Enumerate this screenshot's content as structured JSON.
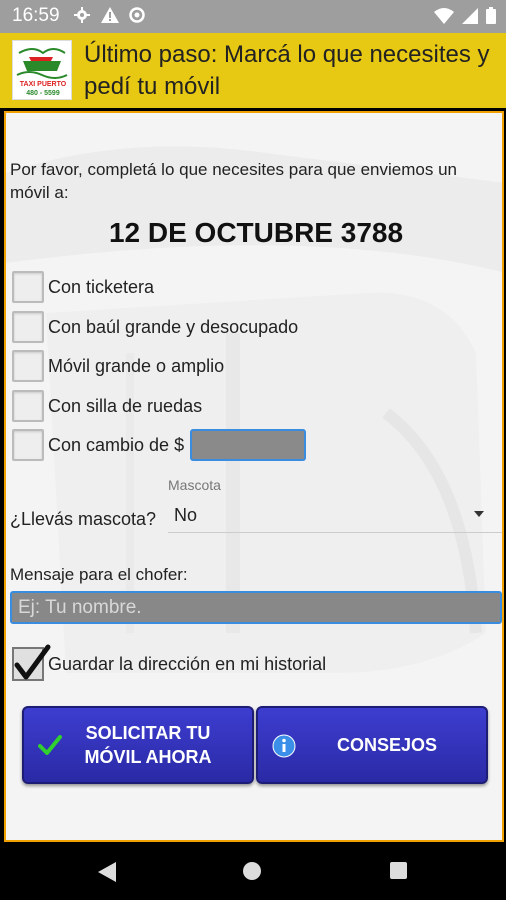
{
  "status_bar": {
    "time": "16:59",
    "left_icons": [
      "gear-icon",
      "warning-icon",
      "data-saver-icon"
    ],
    "right_icons": [
      "wifi-icon",
      "signal-icon",
      "battery-icon"
    ]
  },
  "header": {
    "title": "Último paso: Marcá lo que necesites y pedí tu móvil",
    "logo": {
      "line1": "TAXI PUERTO",
      "line2": "480 - 5599"
    },
    "background_color": "#e7c812"
  },
  "form": {
    "intro": "Por favor, completá lo que necesites para que enviemos un móvil a:",
    "address": "12 DE OCTUBRE 3788",
    "options": [
      {
        "label": "Con ticketera",
        "checked": false
      },
      {
        "label": "Con baúl grande y desocupado",
        "checked": false
      },
      {
        "label": "Móvil grande o amplio",
        "checked": false
      },
      {
        "label": "Con silla de ruedas",
        "checked": false
      },
      {
        "label": "Con cambio de $",
        "checked": false
      }
    ],
    "change_amount": "",
    "pet": {
      "question": "¿Llevás mascota?",
      "caption": "Mascota",
      "selected": "No"
    },
    "message": {
      "label": "Mensaje para el chofer:",
      "placeholder": "Ej: Tu nombre.",
      "value": ""
    },
    "save_history": {
      "label": "Guardar la dirección en mi historial",
      "checked": true
    }
  },
  "buttons": {
    "request": {
      "label_line1": "SOLICITAR TU",
      "label_line2": "MÓVIL AHORA",
      "icon": "checkmark-icon"
    },
    "tips": {
      "label": "CONSEJOS",
      "icon": "info-icon"
    }
  },
  "colors": {
    "accent_border": "#f0a000",
    "button": "#3333c0",
    "input_focus": "#3a8dde"
  }
}
